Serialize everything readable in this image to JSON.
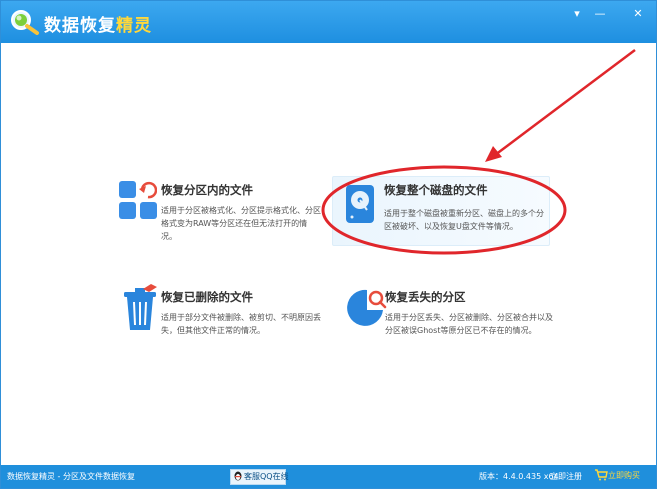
{
  "app": {
    "title_main": "数据恢复",
    "title_accent": "精灵"
  },
  "window_controls": [
    {
      "name": "menu",
      "glyph": "▾"
    },
    {
      "name": "minimize",
      "glyph": "—"
    },
    {
      "name": "close",
      "glyph": "✕"
    }
  ],
  "options": [
    {
      "title": "恢复分区内的文件",
      "desc": "适用于分区被格式化、分区提示格式化、分区格式变为RAW等分区还在但无法打开的情况。",
      "icon": "partition-files-icon"
    },
    {
      "title": "恢复整个磁盘的文件",
      "desc": "适用于整个磁盘被重新分区、磁盘上的多个分区被破坏、以及恢复U盘文件等情况。",
      "icon": "disk-icon"
    },
    {
      "title": "恢复已删除的文件",
      "desc": "适用于部分文件被删除、被剪切、不明原因丢失，但其他文件正常的情况。",
      "icon": "recycle-bin-icon"
    },
    {
      "title": "恢复丢失的分区",
      "desc": "适用于分区丢失、分区被删除、分区被合并以及分区被误Ghost等原分区已不存在的情况。",
      "icon": "lost-partition-icon"
    }
  ],
  "status": {
    "left": "数据恢复精灵 - 分区及文件数据恢复",
    "support": "客服QQ在线",
    "version": "版本：4.4.0.435 x64",
    "register": "立即注册",
    "buy": "立即购买"
  },
  "colors": {
    "brand_blue": "#1f8fdc",
    "accent_yellow": "#ffd83a",
    "annotation_red": "#e0262b"
  }
}
